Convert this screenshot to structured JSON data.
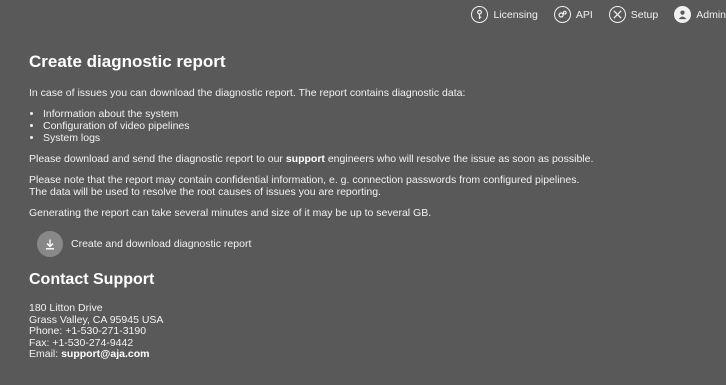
{
  "nav": {
    "licensing": "Licensing",
    "api": "API",
    "setup": "Setup",
    "admin": "Admin"
  },
  "main": {
    "title": "Create diagnostic report",
    "intro": "In case of issues you can download the diagnostic report. The report contains diagnostic data:",
    "items": [
      "Information about the system",
      "Configuration of video pipelines",
      "System logs"
    ],
    "download_pre": "Please download and send the diagnostic report to our ",
    "download_bold": "support",
    "download_post": " engineers who will resolve the issue as soon as possible.",
    "note_line1": "Please note that the report may contain confidential information, e. g. connection passwords from configured pipelines.",
    "note_line2": "The data will be used to resolve the root causes of issues you are reporting.",
    "generating": "Generating the report can take several minutes and size of it may be up to several GB.",
    "download_button": "Create and download diagnostic report"
  },
  "contact": {
    "title": "Contact Support",
    "address1": "180 Litton Drive",
    "address2": "Grass Valley, CA 95945 USA",
    "phone": "Phone: +1-530-271-3190",
    "fax": "Fax: +1-530-274-9442",
    "email_label": "Email: ",
    "email": "support@aja.com"
  }
}
